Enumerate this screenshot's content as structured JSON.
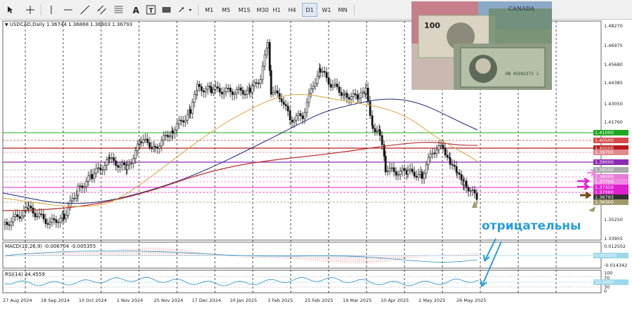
{
  "toolbar": {
    "timeframes": [
      "M1",
      "M5",
      "M15",
      "M30",
      "H1",
      "H4",
      "D1",
      "W1",
      "MN"
    ],
    "active_timeframe": "D1"
  },
  "chart": {
    "header": "USDCAD,Daily  1.36744 1.36868 1.36603 1.36793",
    "annotation": "отрицательны"
  },
  "macd": {
    "header": "MACD(12,26,9) -0.006704 -0.005355",
    "tick_labels": [
      "0.012502",
      "0.000000",
      "-0.014342"
    ]
  },
  "rsi": {
    "header": "RSI(14) 34.4559",
    "tick_labels": [
      "100",
      "70",
      "30",
      "0"
    ],
    "highlight": "50.0000"
  },
  "price_axis": {
    "tick_labels": [
      "1.48270",
      "1.46975",
      "1.45680",
      "1.44385",
      "1.43050",
      "1.41760",
      "1.41000",
      "1.39700",
      "1.38550",
      "1.37350",
      "1.36230",
      "1.35250",
      "1.33955"
    ]
  },
  "price_tags": [
    {
      "label": "1.41000",
      "color": "#21a821"
    },
    {
      "label": "1.40500",
      "color": "#d44b4b"
    },
    {
      "label": "1.40000",
      "color": "#b81a1a"
    },
    {
      "label": "1.39700",
      "color": "#e08a8a"
    },
    {
      "label": "1.39000",
      "color": "#8d2bb3"
    },
    {
      "label": "1.38550",
      "color": "#aaaaaa"
    },
    {
      "label": "1.38000",
      "color": "#e97bd7"
    },
    {
      "label": "1.37750",
      "color": "#f08ce0"
    },
    {
      "label": "1.37350",
      "color": "#e01fcf"
    },
    {
      "label": "1.37000",
      "color": "#e01fcf"
    },
    {
      "label": "1.36793",
      "color": "#333333"
    },
    {
      "label": "1.36300",
      "color": "#a09a6a"
    }
  ],
  "date_axis": {
    "labels": [
      "27 Aug 2024",
      "18 Sep 2024",
      "10 Oct 2024",
      "1 Nov 2024",
      "25 Nov 2024",
      "17 Dec 2024",
      "10 Jan 2025",
      "3 Feb 2025",
      "25 Feb 2025",
      "19 Mar 2025",
      "10 Apr 2025",
      "2 May 2025",
      "26 May 2025"
    ]
  },
  "banknotes": {
    "denomination": "100",
    "country": "CANADA",
    "serial": "HB 05992373 J"
  }
}
